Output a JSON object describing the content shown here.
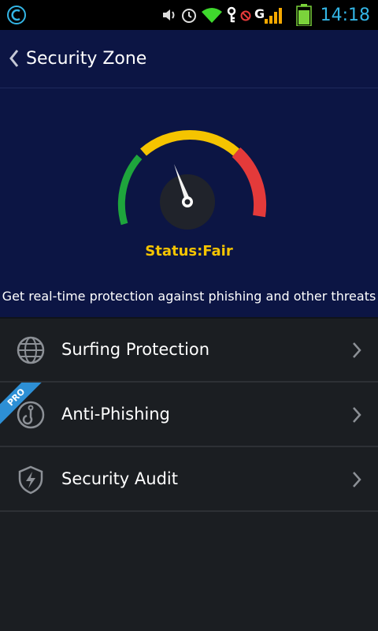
{
  "statusbar": {
    "time": "14:18",
    "icons": [
      "app-c-icon",
      "volume-icon",
      "alarm-icon",
      "wifi-icon",
      "key-icon",
      "no-sim-icon",
      "signal-icon",
      "battery-icon"
    ],
    "battery_color": "#7bd33b",
    "time_color": "#33b5e5"
  },
  "header": {
    "title": "Security Zone",
    "background": "#0c1544"
  },
  "gauge": {
    "status": "Status:Fair",
    "level": "fair",
    "segments": [
      {
        "name": "good",
        "color": "#1ea53c"
      },
      {
        "name": "fair",
        "color": "#f5c400"
      },
      {
        "name": "poor",
        "color": "#e43a3a"
      }
    ]
  },
  "hero": {
    "description": "Get real-time protection against phishing and other threats"
  },
  "menu": {
    "items": [
      {
        "label": "Surfing Protection",
        "icon": "globe-icon"
      },
      {
        "label": "Anti-Phishing",
        "icon": "hook-icon",
        "badge": "PRO"
      },
      {
        "label": "Security Audit",
        "icon": "shield-lightning-icon"
      }
    ]
  }
}
